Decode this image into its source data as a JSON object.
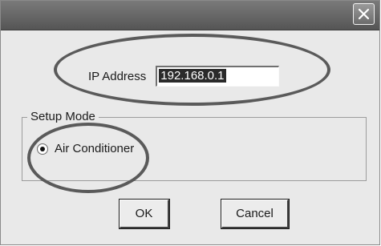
{
  "dialog": {
    "close_icon": "close-x-icon"
  },
  "ip": {
    "label": "IP Address",
    "value": "192.168.0.1"
  },
  "setup_mode": {
    "title": "Setup Mode",
    "option_label": "Air Conditioner",
    "selected": true
  },
  "buttons": {
    "ok_label": "OK",
    "cancel_label": "Cancel"
  },
  "colors": {
    "titlebar": "#5f5f5f",
    "dialog_bg": "#e9e9e9",
    "annotation": "#5a5a5a"
  }
}
